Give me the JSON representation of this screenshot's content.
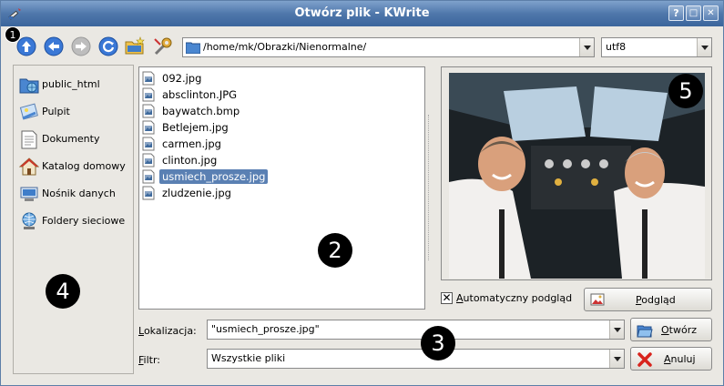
{
  "window": {
    "title": "Otwórz plik - KWrite",
    "buttons": {
      "help": "?",
      "maximize": "□",
      "close": "✕"
    }
  },
  "toolbar": {
    "path": "/home/mk/Obrazki/Nienormalne/",
    "encoding": "utf8"
  },
  "sidebar": {
    "items": [
      {
        "label": "public_html",
        "icon": "globe-folder-icon"
      },
      {
        "label": "Pulpit",
        "icon": "desktop-icon"
      },
      {
        "label": "Dokumenty",
        "icon": "document-icon"
      },
      {
        "label": "Katalog domowy",
        "icon": "home-icon"
      },
      {
        "label": "Nośnik danych",
        "icon": "drive-icon"
      },
      {
        "label": "Foldery sieciowe",
        "icon": "network-icon"
      }
    ]
  },
  "files": [
    {
      "name": "092.jpg"
    },
    {
      "name": "absclinton.JPG"
    },
    {
      "name": "baywatch.bmp"
    },
    {
      "name": "Betlejem.jpg"
    },
    {
      "name": "carmen.jpg"
    },
    {
      "name": "clinton.jpg"
    },
    {
      "name": "usmiech_prosze.jpg",
      "selected": true
    },
    {
      "name": "zludzenie.jpg"
    }
  ],
  "preview": {
    "auto_preview_label_pre": "",
    "auto_preview_label_u": "A",
    "auto_preview_label_post": "utomatyczny podgląd",
    "auto_preview_checked": "✕",
    "preview_button_u": "P",
    "preview_button_post": "odgląd"
  },
  "location": {
    "label_u": "L",
    "label_post": "okalizacja:",
    "value": "\"usmiech_prosze.jpg\""
  },
  "filter": {
    "label_u": "F",
    "label_post": "iltr:",
    "value": "Wszystkie pliki"
  },
  "actions": {
    "open_u": "O",
    "open_post": "twórz",
    "cancel_u": "A",
    "cancel_post": "nuluj"
  },
  "badges": [
    "1",
    "2",
    "3",
    "4",
    "5"
  ],
  "colors": {
    "titlebar": "#4f77ab",
    "selection": "#5a80b3",
    "accent_blue": "#3a78d6"
  }
}
